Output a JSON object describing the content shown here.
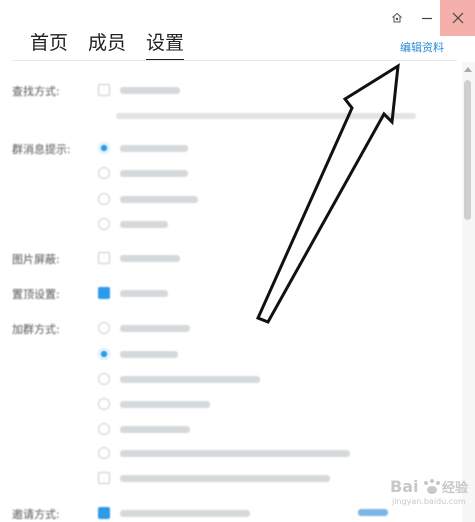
{
  "window": {
    "skin_icon": "skin-icon",
    "minimize_icon": "minimize-icon",
    "close_icon": "close-icon",
    "close_bg": "#f6b0ac"
  },
  "tabs": [
    {
      "label": "首页",
      "active": false
    },
    {
      "label": "成员",
      "active": false
    },
    {
      "label": "设置",
      "active": true
    }
  ],
  "edit_profile": "编辑资料",
  "sections": {
    "search": {
      "label": "查找方式:"
    },
    "notify": {
      "label": "群消息提示:"
    },
    "image_block": {
      "label": "图片屏蔽:"
    },
    "pin": {
      "label": "置顶设置:"
    },
    "join": {
      "label": "加群方式:"
    },
    "invite": {
      "label": "邀请方式:"
    }
  },
  "watermark": {
    "text": "Bai",
    "suffix": "经验",
    "sub": "jingyan.baidu.com"
  },
  "accent": "#2b9ae8",
  "link_color": "#2b8bd6"
}
